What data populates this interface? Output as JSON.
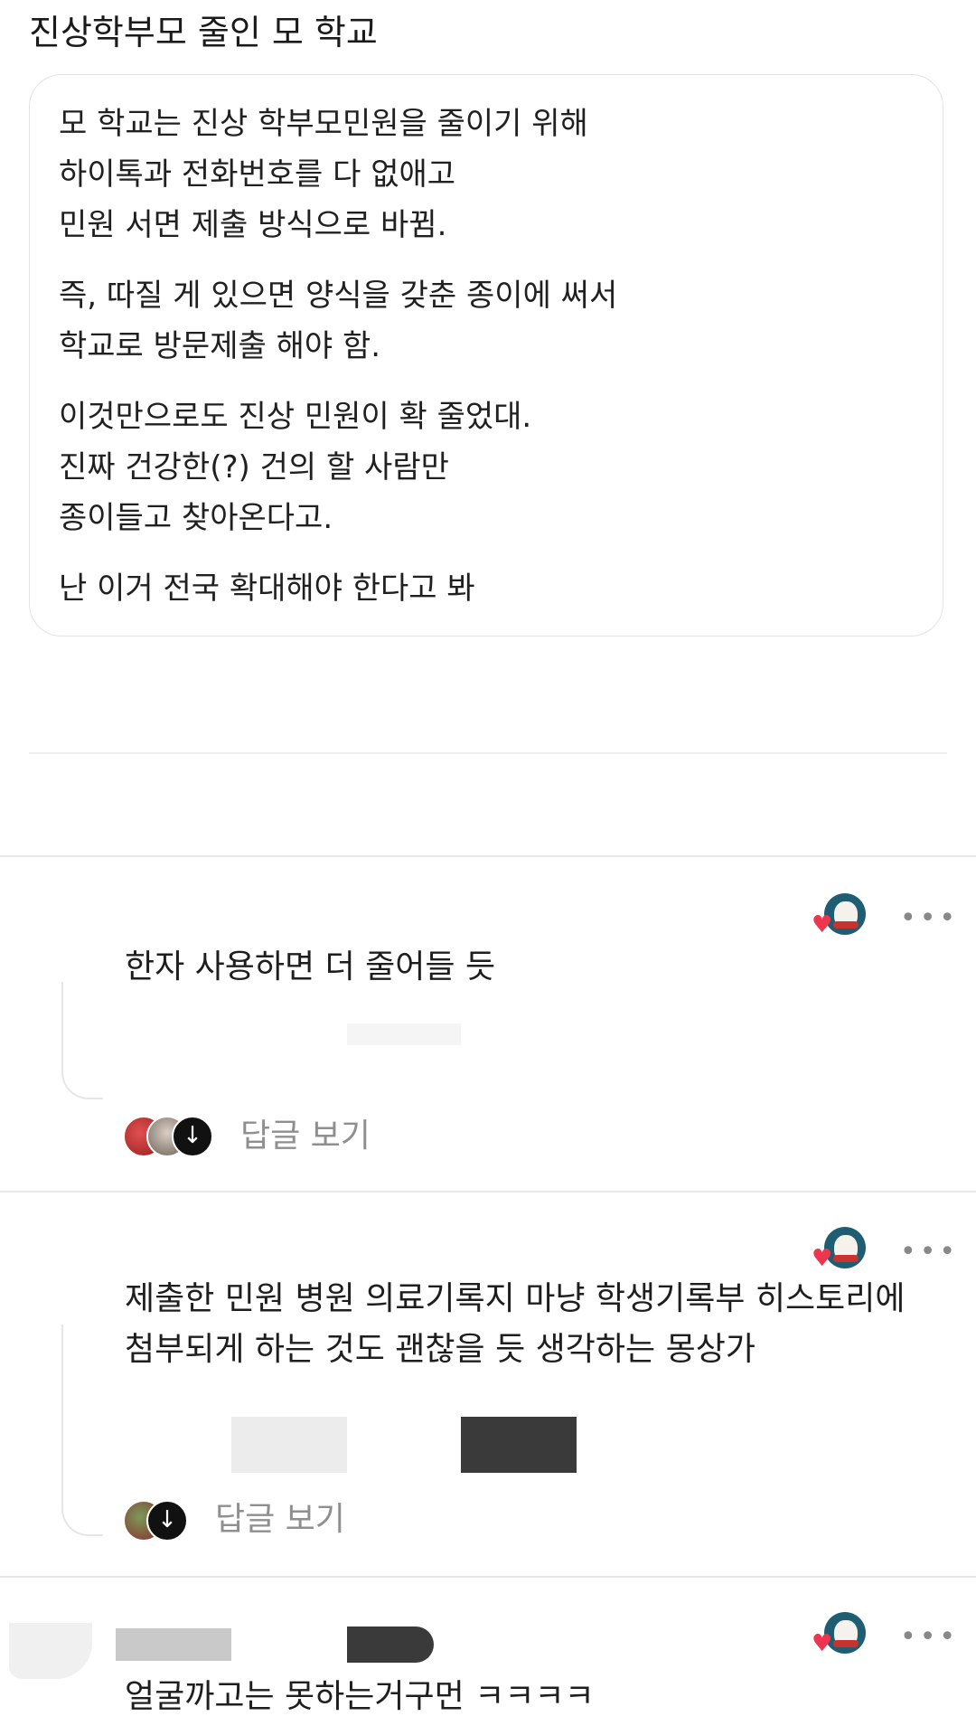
{
  "post": {
    "title": "진상학부모 줄인 모 학교",
    "paragraphs": [
      [
        "모 학교는 진상 학부모민원을 줄이기 위해",
        "하이톡과 전화번호를 다 없애고",
        "민원 서면 제출 방식으로 바뀜."
      ],
      [
        "즉, 따질 게 있으면 양식을 갖춘 종이에 써서",
        "학교로 방문제출 해야 함."
      ],
      [
        "이것만으로도 진상 민원이 확 줄었대.",
        "진짜 건강한(?) 건의 할 사람만",
        "종이들고 찾아온다고."
      ],
      [
        "난 이거 전국 확대해야 한다고 봐"
      ]
    ]
  },
  "comments": [
    {
      "text_lines": [
        "한자 사용하면 더 줄어들 듯"
      ],
      "reply_label": "답글 보기"
    },
    {
      "text_lines": [
        "제출한 민원 병원 의료기록지 마냥 학생기록부 히스토리에",
        "첨부되게 하는 것도 괜찮을 듯 생각하는 몽상가"
      ],
      "reply_label": "답글 보기"
    },
    {
      "text_lines": [
        "얼굴까고는 못하는거구먼 ㅋㅋㅋㅋ"
      ]
    }
  ],
  "icons": {
    "more": "more-horizontal-icon",
    "heart": "heart-icon",
    "reply_arrow": "arrow-down-circle-icon"
  },
  "colors": {
    "heart": "#ee3550",
    "muted_text": "#8f8f8f",
    "avatar_bg": "#1f5e72"
  }
}
